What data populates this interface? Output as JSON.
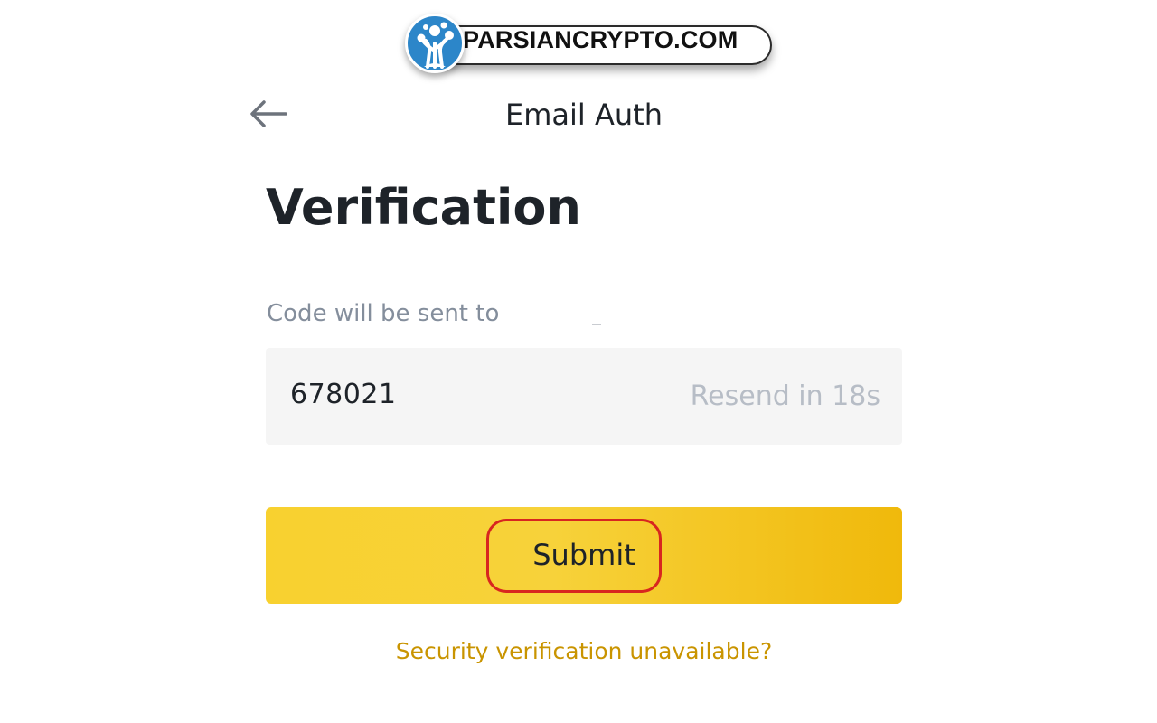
{
  "watermark": {
    "text": "PARSIANCRYPTO.COM",
    "logo_icon": "tree-logo-icon"
  },
  "header": {
    "back_icon": "arrow-left-icon",
    "title": "Email Auth"
  },
  "main": {
    "heading": "Verification",
    "sent_to_label": "Code will be sent to",
    "code_field": {
      "value": "678021",
      "resend_label": "Resend in 18s"
    },
    "submit_label": "Submit",
    "help_link": "Security verification unavailable?"
  },
  "colors": {
    "accent": "#F0B90B",
    "link": "#C99400",
    "highlight": "#D8261F",
    "text_primary": "#1E2329",
    "text_secondary": "#848E9C"
  }
}
